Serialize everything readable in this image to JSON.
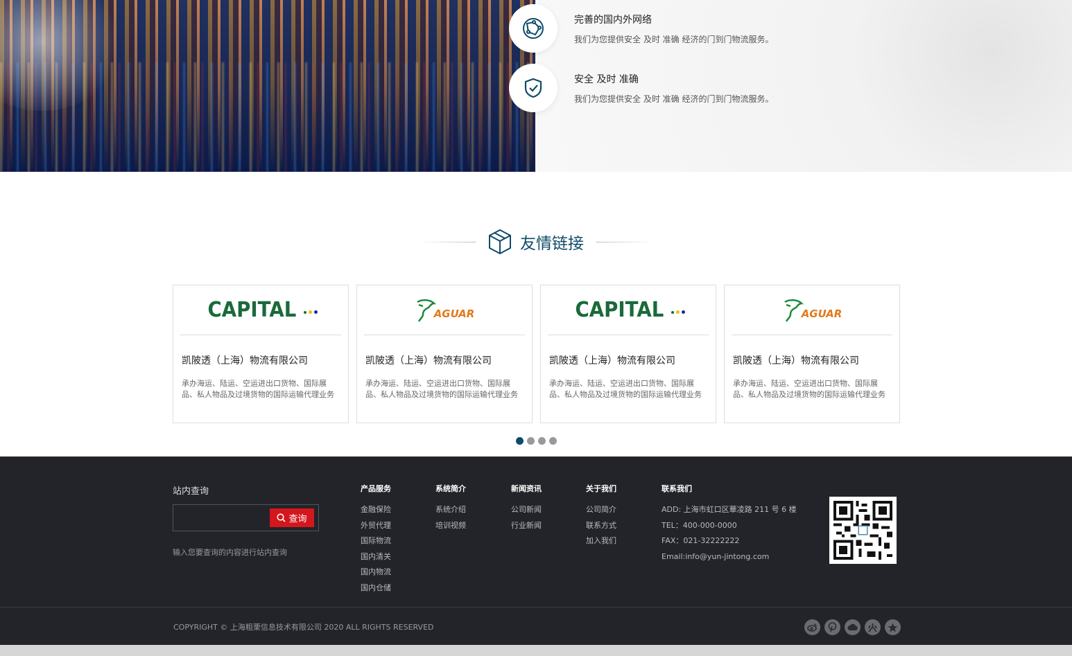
{
  "features": [
    {
      "icon": "globe-network-icon",
      "title": "完善的国内外网络",
      "desc": "我们为您提供安全 及时 准确 经济的门到门物流服务。"
    },
    {
      "icon": "shield-check-icon",
      "title": "安全 及时 准确",
      "desc": "我们为您提供安全 及时 准确 经济的门到门物流服务。"
    }
  ],
  "links_section": {
    "title": "友情链接",
    "icon": "box-icon"
  },
  "cards": [
    {
      "logo": "CAPITAL",
      "name": "凯陂透（上海）物流有限公司",
      "desc": "承办海运、陆运、空运进出口货物、国际展品、私人物品及过境货物的国际运输代理业务"
    },
    {
      "logo": "AGUAR",
      "name": "凯陂透（上海）物流有限公司",
      "desc": "承办海运、陆运、空运进出口货物、国际展品、私人物品及过境货物的国际运输代理业务"
    },
    {
      "logo": "CAPITAL",
      "name": "凯陂透（上海）物流有限公司",
      "desc": "承办海运、陆运、空运进出口货物、国际展品、私人物品及过境货物的国际运输代理业务"
    },
    {
      "logo": "AGUAR",
      "name": "凯陂透（上海）物流有限公司",
      "desc": "承办海运、陆运、空运进出口货物、国际展品、私人物品及过境货物的国际运输代理业务"
    }
  ],
  "pager": {
    "count": 4,
    "active": 0
  },
  "footer": {
    "search": {
      "title": "站内查询",
      "button": "查询",
      "placeholder": "",
      "tip": "输入您要查询的内容进行站内查询"
    },
    "columns": [
      {
        "title": "产品服务",
        "items": [
          "金融保险",
          "外贸代理",
          "国际物流",
          "国内清关",
          "国内物流",
          "国内仓储"
        ]
      },
      {
        "title": "系统简介",
        "items": [
          "系统介绍",
          "培训视频"
        ]
      },
      {
        "title": "新闻资讯",
        "items": [
          "公司新闻",
          "行业新闻"
        ]
      },
      {
        "title": "关于我们",
        "items": [
          "公司简介",
          "联系方式",
          "加入我们"
        ]
      }
    ],
    "contact": {
      "title": "联系我们",
      "lines": [
        "ADD: 上海市虹口区華凌路 211 号 6 楼",
        "TEL：400-000-0000",
        "FAX：021-32222222",
        "Email:info@yun-jintong.com"
      ]
    },
    "copyright": "COPYRIGHT  ©  上海粗栗信息技术有限公司  2020    ALL RIGHTS RESERVED",
    "social_icons": [
      "weibo-icon",
      "pinterest-icon",
      "cloud-icon",
      "renren-icon",
      "star-icon"
    ]
  },
  "colors": {
    "accent": "#0f4a6a",
    "footer_bg": "#23242a",
    "search_btn": "#d4161d",
    "capital_green": "#1a6a3a",
    "jaguar_orange": "#e07a1a"
  }
}
